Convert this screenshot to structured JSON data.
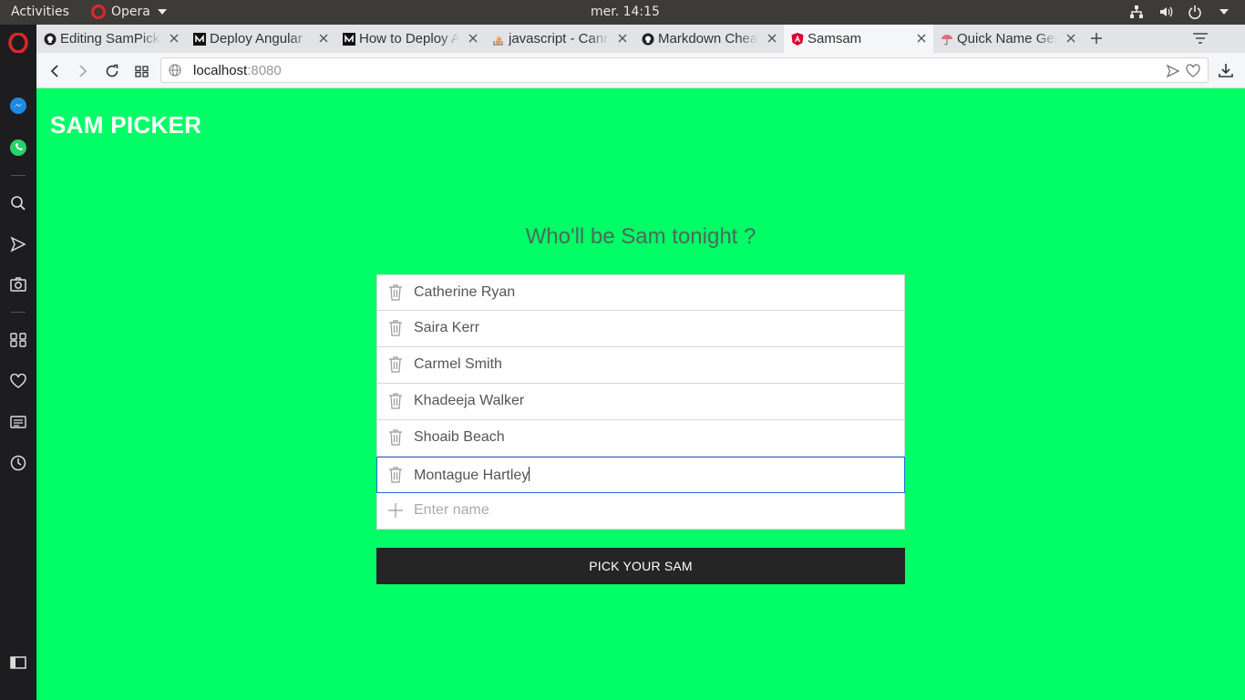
{
  "os_bar": {
    "activities": "Activities",
    "app_name": "Opera",
    "clock": "mer. 14:15"
  },
  "tabs": [
    {
      "title": "Editing SamPicker",
      "icon": "github-icon",
      "active": false
    },
    {
      "title": "Deploy Angular",
      "icon": "medium-icon",
      "active": false
    },
    {
      "title": "How to Deploy A",
      "icon": "medium-icon",
      "active": false
    },
    {
      "title": "javascript - Cann",
      "icon": "stackoverflow-icon",
      "active": false
    },
    {
      "title": "Markdown Chea",
      "icon": "github-icon",
      "active": false
    },
    {
      "title": "Samsam",
      "icon": "angular-icon",
      "active": true
    },
    {
      "title": "Quick Name Ger",
      "icon": "umbrella-icon",
      "active": false
    }
  ],
  "address": {
    "host": "localhost",
    "port": ":8080"
  },
  "app": {
    "brand": "SAM PICKER",
    "question": "Who'll be Sam tonight ?",
    "names": [
      "Catherine Ryan",
      "Saira Kerr",
      "Carmel Smith",
      "Khadeeja Walker",
      "Shoaib Beach",
      "Montague Hartley"
    ],
    "new_name_placeholder": "Enter name",
    "pick_button": "PICK YOUR SAM"
  },
  "colors": {
    "page_background": "#00ff66",
    "button_background": "#252525",
    "focus_border": "#1e6fd9"
  }
}
